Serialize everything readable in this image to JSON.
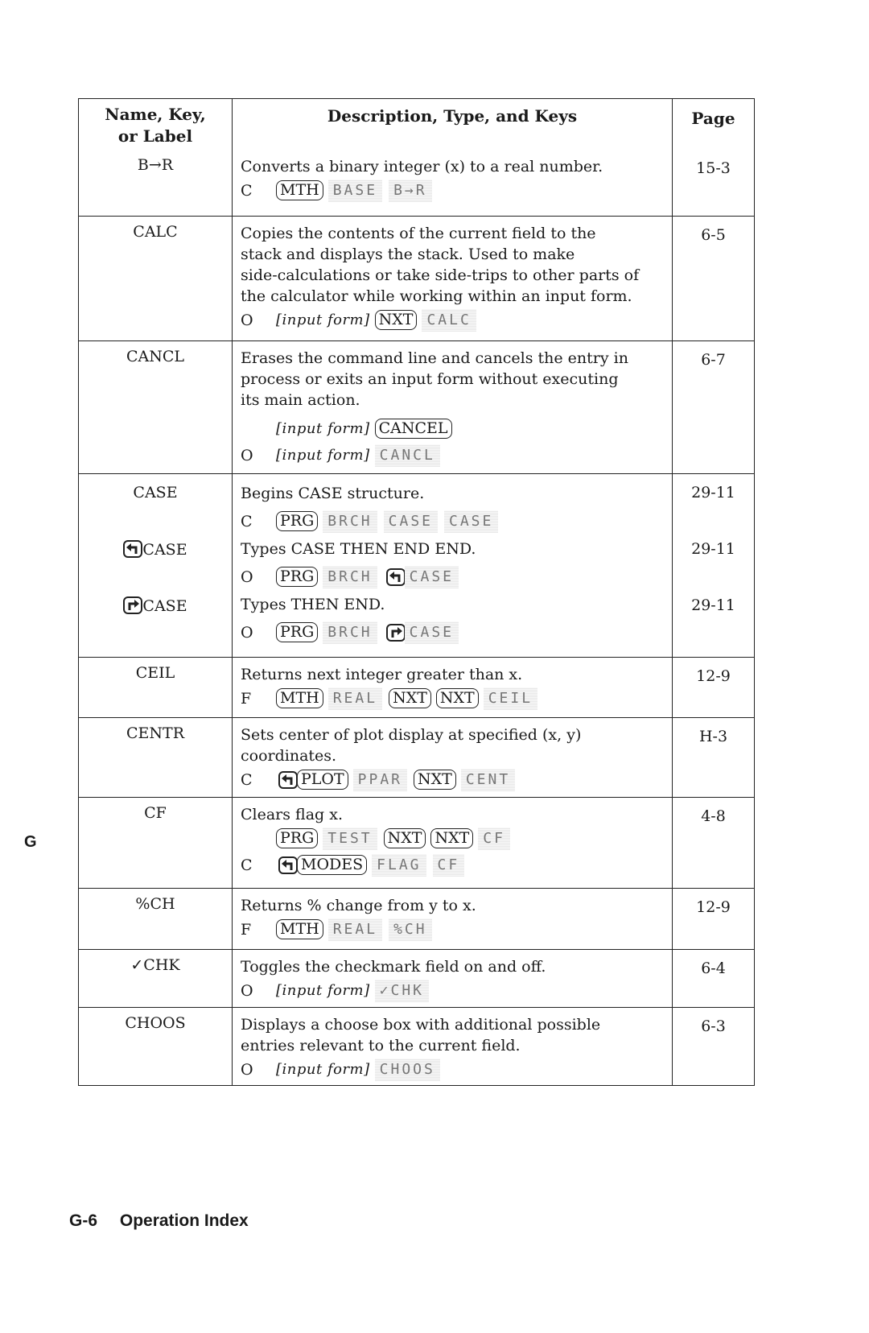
{
  "table": {
    "headers": {
      "name_line1": "Name, Key,",
      "name_line2": "or Label",
      "description": "Description, Type, and Keys",
      "page": "Page"
    },
    "rows": [
      {
        "name": "B→R",
        "desc": [
          "Converts a binary integer (x) to a real number."
        ],
        "keys": [
          {
            "type": "C",
            "seq": [
              [
                "key",
                "MTH"
              ],
              [
                "soft",
                "BASE"
              ],
              [
                "soft",
                "B→R"
              ]
            ]
          }
        ],
        "page": "15-3"
      },
      {
        "name": "CALC",
        "desc": [
          "Copies the contents of the current field to the",
          "stack and displays the stack. Used to make",
          "side-calculations or take side-trips to other parts of",
          "the calculator while working within an input form."
        ],
        "keys": [
          {
            "type": "O",
            "seq": [
              [
                "ital",
                "[input form]"
              ],
              [
                "key",
                "NXT"
              ],
              [
                "soft",
                "CALC"
              ]
            ]
          }
        ],
        "page": "6-5"
      },
      {
        "name": "CANCL",
        "desc": [
          "Erases the command line and cancels the entry in",
          "process or exits an input form without executing",
          "its main action."
        ],
        "keys": [
          {
            "type": "",
            "seq": [
              [
                "ital",
                "[input form]"
              ],
              [
                "key",
                "CANCEL"
              ]
            ]
          },
          {
            "type": "O",
            "seq": [
              [
                "ital",
                "[input form]"
              ],
              [
                "soft",
                "CANCL"
              ]
            ]
          }
        ],
        "page": "6-7"
      },
      {
        "name": "CASE",
        "sub": [
          {
            "label": "CASE",
            "prefix": "",
            "desc": "Begins CASE structure.",
            "type": "C",
            "seq": [
              [
                "key",
                "PRG"
              ],
              [
                "soft",
                "BRCH"
              ],
              [
                "soft",
                "CASE"
              ],
              [
                "soft",
                "CASE"
              ]
            ],
            "page": "29-11"
          },
          {
            "label": "CASE",
            "prefix": "left-shift",
            "desc": "Types CASE THEN END END.",
            "type": "O",
            "seq": [
              [
                "key",
                "PRG"
              ],
              [
                "soft",
                "BRCH"
              ],
              [
                "lshift",
                ""
              ],
              [
                "soft",
                "CASE"
              ]
            ],
            "page": "29-11"
          },
          {
            "label": "CASE",
            "prefix": "right-shift",
            "desc": "Types THEN END.",
            "type": "O",
            "seq": [
              [
                "key",
                "PRG"
              ],
              [
                "soft",
                "BRCH"
              ],
              [
                "rshift",
                ""
              ],
              [
                "soft",
                "CASE"
              ]
            ],
            "page": "29-11"
          }
        ]
      },
      {
        "name": "CEIL",
        "desc": [
          "Returns next integer greater than x."
        ],
        "keys": [
          {
            "type": "F",
            "seq": [
              [
                "key",
                "MTH"
              ],
              [
                "soft",
                "REAL"
              ],
              [
                "key",
                "NXT"
              ],
              [
                "key",
                "NXT"
              ],
              [
                "soft",
                "CEIL"
              ]
            ]
          }
        ],
        "page": "12-9"
      },
      {
        "name": "CENTR",
        "desc": [
          "Sets center of plot display at specified (x, y)",
          "coordinates."
        ],
        "keys": [
          {
            "type": "C",
            "seq": [
              [
                "lshift",
                ""
              ],
              [
                "key",
                "PLOT"
              ],
              [
                "soft",
                "PPAR"
              ],
              [
                "key",
                "NXT"
              ],
              [
                "soft",
                "CENT"
              ]
            ]
          }
        ],
        "page": "H-3"
      },
      {
        "name": "CF",
        "desc": [
          "Clears flag x."
        ],
        "keys": [
          {
            "type": "",
            "seq": [
              [
                "key",
                "PRG"
              ],
              [
                "soft",
                "TEST"
              ],
              [
                "key",
                "NXT"
              ],
              [
                "key",
                "NXT"
              ],
              [
                "soft",
                "CF"
              ]
            ]
          },
          {
            "type": "C",
            "seq": [
              [
                "lshift",
                ""
              ],
              [
                "key",
                "MODES"
              ],
              [
                "soft",
                "FLAG"
              ],
              [
                "soft",
                "CF"
              ]
            ]
          }
        ],
        "page": "4-8"
      },
      {
        "name": "%CH",
        "desc": [
          "Returns % change from y to x."
        ],
        "keys": [
          {
            "type": "F",
            "seq": [
              [
                "key",
                "MTH"
              ],
              [
                "soft",
                "REAL"
              ],
              [
                "soft",
                "%CH"
              ]
            ]
          }
        ],
        "page": "12-9"
      },
      {
        "name": "✓CHK",
        "desc": [
          "Toggles the checkmark field on and off."
        ],
        "keys": [
          {
            "type": "O",
            "seq": [
              [
                "ital",
                "[input form]"
              ],
              [
                "soft",
                "✓CHK"
              ]
            ]
          }
        ],
        "page": "6-4"
      },
      {
        "name": "CHOOS",
        "desc": [
          "Displays a choose box with additional possible",
          "entries relevant to the current field."
        ],
        "keys": [
          {
            "type": "O",
            "seq": [
              [
                "ital",
                "[input form]"
              ],
              [
                "soft",
                "CHOOS"
              ]
            ]
          }
        ],
        "page": "6-3"
      }
    ]
  },
  "side_tab": "G",
  "footer": {
    "page_number": "G-6",
    "section_title": "Operation Index"
  }
}
